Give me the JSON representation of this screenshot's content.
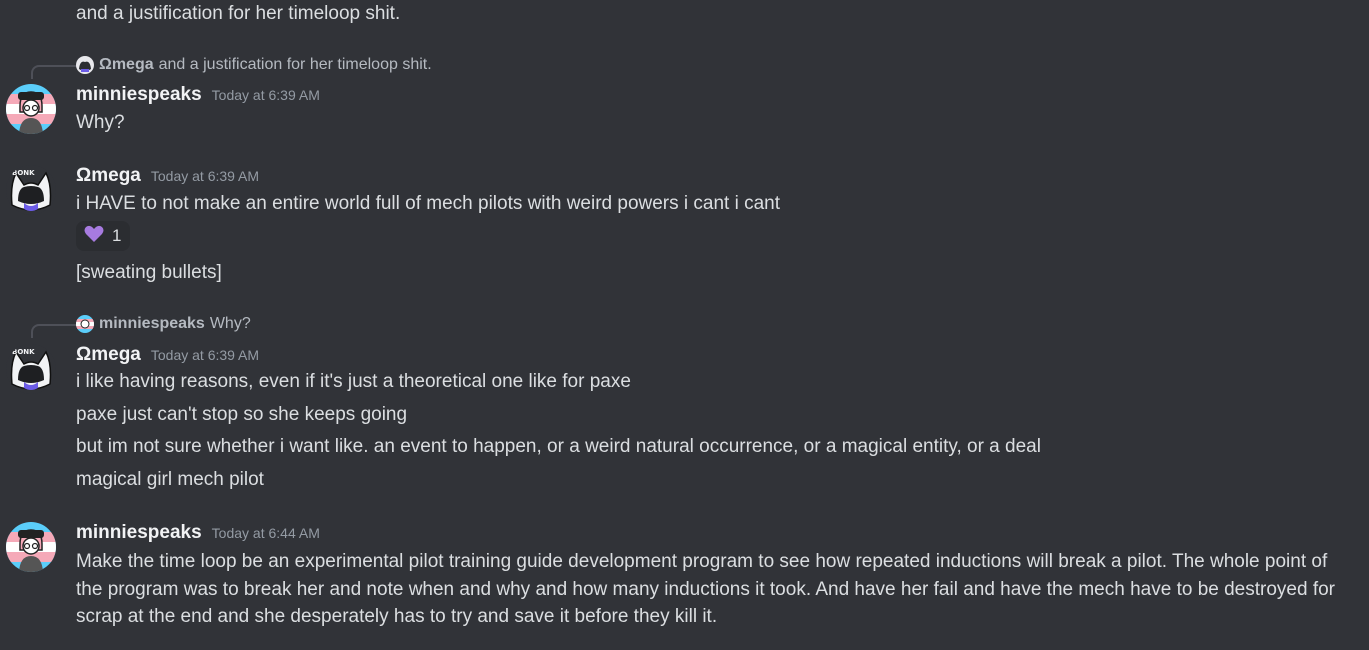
{
  "messages": {
    "m0_line": "and a justification for her timeloop shit.",
    "reply1": {
      "name": "Ωmega",
      "text": "and a justification for her timeloop shit."
    },
    "msg1": {
      "author": "minniespeaks",
      "time": "Today at 6:39 AM",
      "text": "Why?"
    },
    "msg2": {
      "author": "Ωmega",
      "time": "Today at 6:39 AM",
      "text": "i HAVE to not make an entire world full of mech pilots with weird powers i cant i cant",
      "reaction_count": "1",
      "followup": "[sweating bullets]"
    },
    "reply2": {
      "name": "minniespeaks",
      "text": "Why?"
    },
    "msg3": {
      "author": "Ωmega",
      "time": "Today at 6:39 AM",
      "lines": [
        "i like having reasons, even if it's just a theoretical one like for paxe",
        "paxe just can't stop so she keeps going",
        "but im not sure whether i want like. an event to happen, or a weird natural occurrence, or a magical entity, or a deal",
        "magical girl mech pilot"
      ]
    },
    "msg4": {
      "author": "minniespeaks",
      "time": "Today at 6:44 AM",
      "text": "Make the time loop be an experimental pilot training guide development program to see how repeated inductions will break a pilot. The whole point of the program was to break her and note when and why and how many inductions it took. And have her fail and have the mech have to be destroyed for scrap at the end and she desperately has to try and save it before they kill it."
    }
  },
  "colors": {
    "background": "#313338",
    "text": "#dbdee1",
    "username": "#f2f3f5",
    "timestamp": "#949ba4",
    "reaction_bg": "#2b2d31",
    "heart": "#a77be0"
  },
  "icons": {
    "reaction": "purple-heart-icon",
    "avatar_minnie": "trans-flag-character-avatar",
    "avatar_omega": "bonk-cat-avatar"
  }
}
